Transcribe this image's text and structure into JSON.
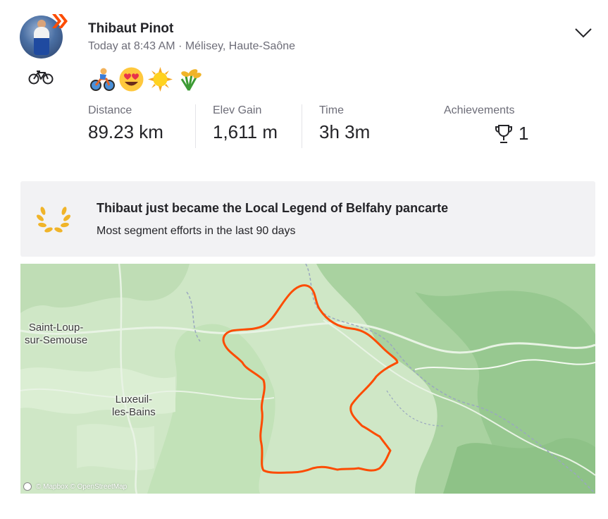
{
  "athlete": {
    "name": "Thibaut Pinot",
    "meta": "Today at 8:43 AM · Mélisey, Haute-Saône"
  },
  "icons": {
    "avatar": "athlete-avatar",
    "badge": "subscriber-chevron-badge",
    "sport": "bicycle-icon",
    "menu": "chevron-down-icon",
    "trophy": "trophy-icon",
    "laurel": "laurel-wreath-icon"
  },
  "emojis": [
    "🚴",
    "😍",
    "🌞",
    "🌾"
  ],
  "stats": [
    {
      "label": "Distance",
      "value": "89.23 km"
    },
    {
      "label": "Elev Gain",
      "value": "1,611 m"
    },
    {
      "label": "Time",
      "value": "3h 3m"
    }
  ],
  "achievements": {
    "label": "Achievements",
    "value": "1"
  },
  "local_legend": {
    "title": "Thibaut just became the Local Legend of Belfahy pancarte",
    "subtitle": "Most segment efforts in the last 90 days"
  },
  "map": {
    "towns": [
      "Saint-Loup-\nsur-Semouse",
      "Luxeuil-\nles-Bains"
    ],
    "attribution": "© Mapbox © OpenStreetMap",
    "route_color": "#fc4c02"
  }
}
